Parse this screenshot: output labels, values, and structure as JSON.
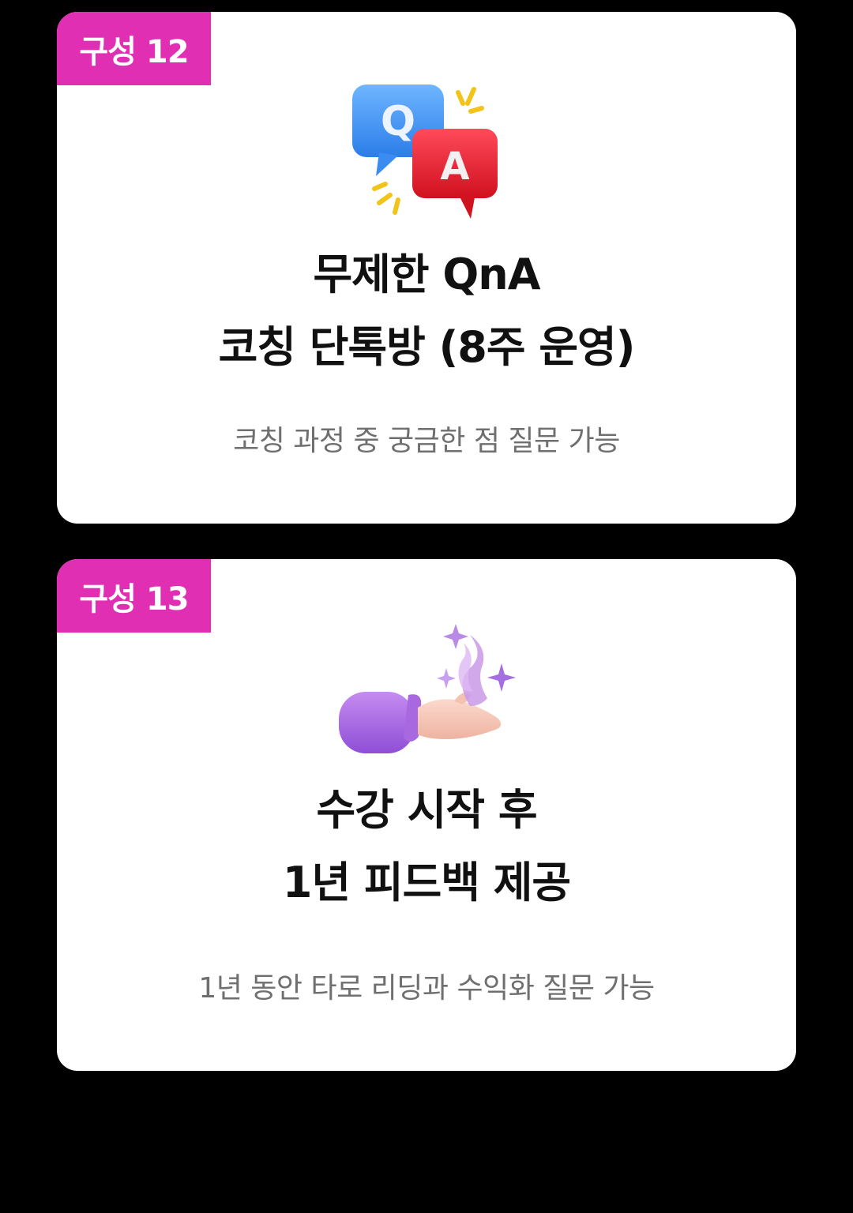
{
  "cards": [
    {
      "badge": "구성 12",
      "icon": "qna-speech-bubbles-icon",
      "title_line1": "무제한 QnA",
      "title_line2": "코칭 단톡방 (8주 운영)",
      "subtitle": "코칭 과정 중 궁금한 점 질문 가능"
    },
    {
      "badge": "구성 13",
      "icon": "magic-hand-icon",
      "title_line1": "수강 시작 후",
      "title_line2": "1년 피드백 제공",
      "subtitle": "1년 동안 타로 리딩과 수익화 질문 가능"
    }
  ],
  "colors": {
    "badge": "#e12fb4",
    "background": "#000000",
    "card": "#ffffff"
  }
}
